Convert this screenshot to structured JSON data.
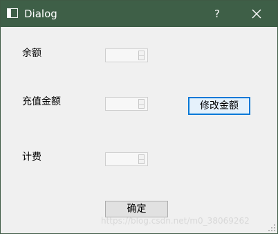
{
  "window": {
    "title": "Dialog",
    "help_label": "?"
  },
  "form": {
    "balance": {
      "label": "余额",
      "value": ""
    },
    "recharge": {
      "label": "充值金额",
      "value": ""
    },
    "fee": {
      "label": "计费",
      "value": ""
    }
  },
  "buttons": {
    "modify_amount": "修改金额",
    "confirm": "确定"
  },
  "watermark": "https://blog.csdn.net/m0_38069262",
  "colors": {
    "titlebar": "#3e5f47",
    "client_background": "#f0f0f0",
    "focus_accent": "#0078d7"
  },
  "icons": {
    "app": "window-app-icon",
    "help": "question-mark",
    "close": "close-x-icon",
    "spin": "spin-arrows-icon",
    "grip": "resize-grip-icon"
  }
}
